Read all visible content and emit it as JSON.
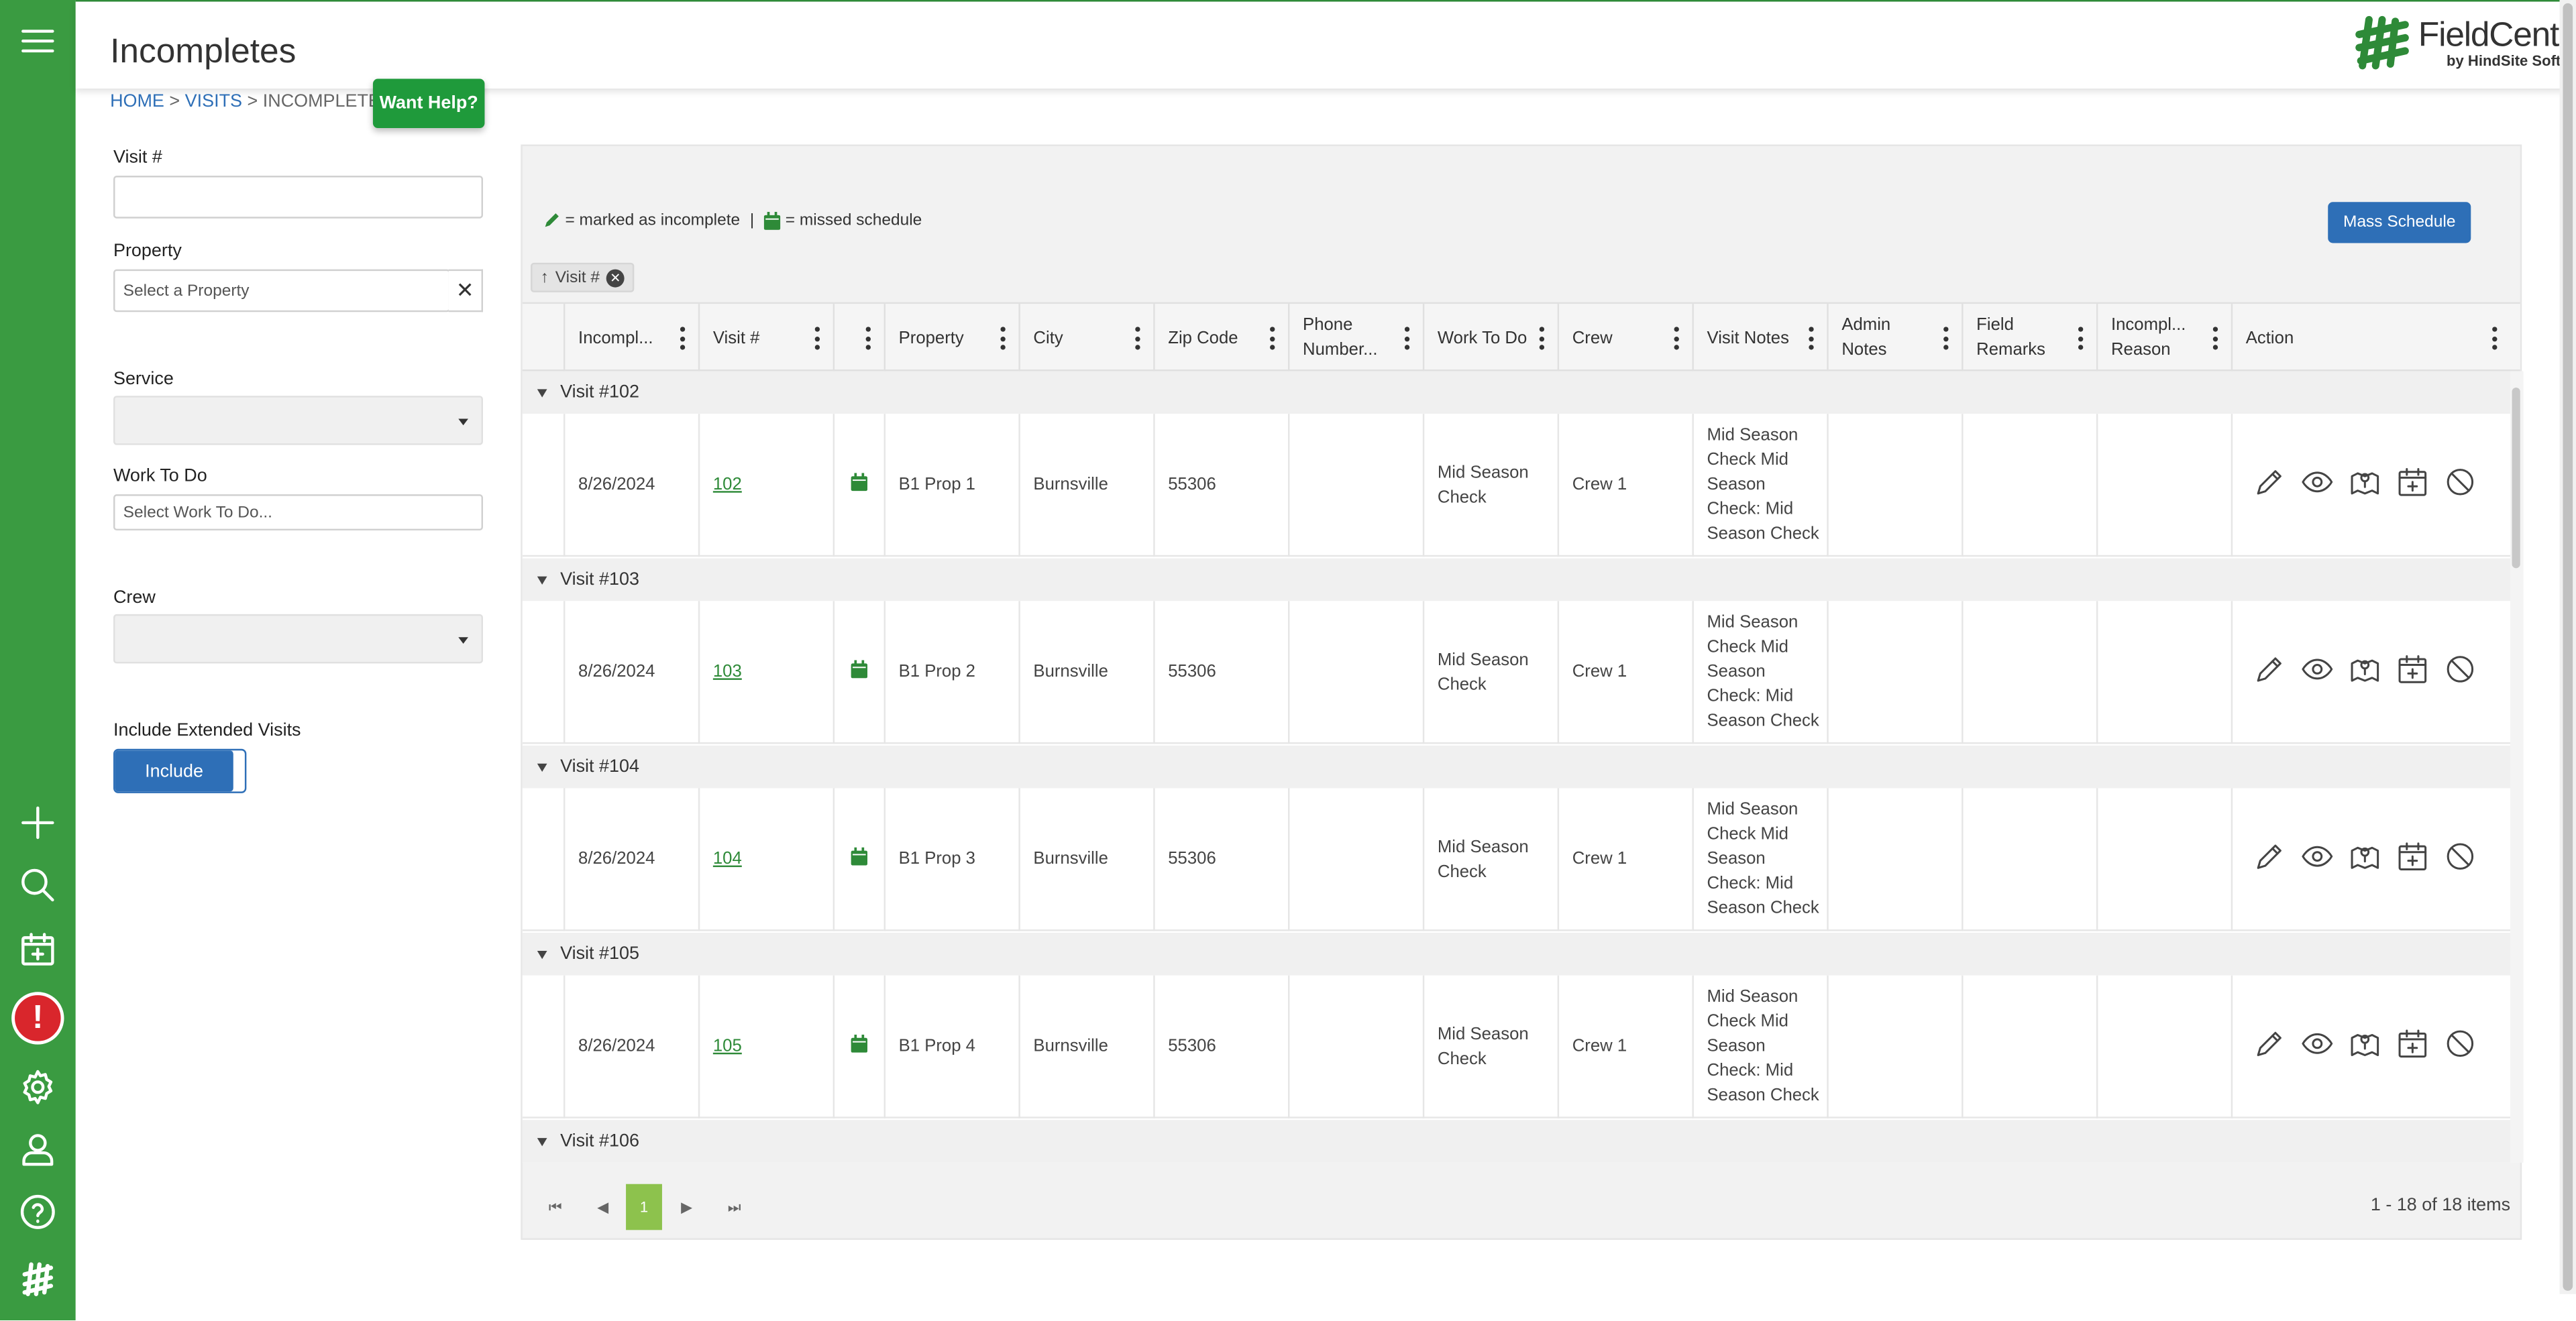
{
  "page": {
    "title": "Incompletes"
  },
  "breadcrumb": {
    "home": "HOME",
    "visits": "VISITS",
    "current": "INCOMPLETES",
    "sep": ">"
  },
  "help_button": "Want Help?",
  "logo": {
    "main": "FieldCentral",
    "sub": "by HindSite Software"
  },
  "filters": {
    "visit_label": "Visit #",
    "visit_value": "",
    "property_label": "Property",
    "property_placeholder": "Select a Property",
    "service_label": "Service",
    "work_label": "Work To Do",
    "work_placeholder": "Select Work To Do...",
    "crew_label": "Crew",
    "extended_label": "Include Extended Visits",
    "extended_toggle": "Include"
  },
  "legend": {
    "incomplete": "= marked as incomplete",
    "divider": "|",
    "missed": "= missed schedule"
  },
  "mass_schedule": "Mass Schedule",
  "grouping": {
    "chip": "Visit #",
    "arrow": "↑"
  },
  "columns": [
    "Incompl...",
    "Visit #",
    "",
    "Property",
    "City",
    "Zip Code",
    "Phone Number...",
    "Work To Do",
    "Crew",
    "Visit Notes",
    "Admin Notes",
    "Field Remarks",
    "Incompl... Reason",
    "Action"
  ],
  "groups": [
    {
      "label": "Visit #102",
      "row": {
        "date": "8/26/2024",
        "visit": "102",
        "property": "B1 Prop 1",
        "city": "Burnsville",
        "zip": "55306",
        "phone": "",
        "work": "Mid Season Check",
        "crew": "Crew 1",
        "notes": "Mid Season Check Mid Season Check: Mid Season Check",
        "admin": "",
        "remarks": "",
        "reason": ""
      }
    },
    {
      "label": "Visit #103",
      "row": {
        "date": "8/26/2024",
        "visit": "103",
        "property": "B1 Prop 2",
        "city": "Burnsville",
        "zip": "55306",
        "phone": "",
        "work": "Mid Season Check",
        "crew": "Crew 1",
        "notes": "Mid Season Check Mid Season Check: Mid Season Check",
        "admin": "",
        "remarks": "",
        "reason": ""
      }
    },
    {
      "label": "Visit #104",
      "row": {
        "date": "8/26/2024",
        "visit": "104",
        "property": "B1 Prop 3",
        "city": "Burnsville",
        "zip": "55306",
        "phone": "",
        "work": "Mid Season Check",
        "crew": "Crew 1",
        "notes": "Mid Season Check Mid Season Check: Mid Season Check",
        "admin": "",
        "remarks": "",
        "reason": ""
      }
    },
    {
      "label": "Visit #105",
      "row": {
        "date": "8/26/2024",
        "visit": "105",
        "property": "B1 Prop 4",
        "city": "Burnsville",
        "zip": "55306",
        "phone": "",
        "work": "Mid Season Check",
        "crew": "Crew 1",
        "notes": "Mid Season Check Mid Season Check: Mid Season Check",
        "admin": "",
        "remarks": "",
        "reason": ""
      }
    },
    {
      "label": "Visit #106"
    }
  ],
  "pager": {
    "current": "1",
    "info": "1 - 18 of 18 items"
  },
  "icons": {
    "sidebar": [
      "menu-icon",
      "plus-icon",
      "search-icon",
      "calendar-add-icon",
      "alert-icon",
      "gear-icon",
      "user-icon",
      "help-icon",
      "fieldcentral-logo-icon"
    ],
    "actions": [
      "pencil-icon",
      "eye-icon",
      "map-pin-icon",
      "calendar-add-icon",
      "cancel-icon"
    ]
  },
  "colors": {
    "sidebar": "#3a9b41",
    "link": "#2e6fb7",
    "accent_green": "#2e8a38",
    "button_blue": "#2e6fb7",
    "alert_red": "#d9262c",
    "pager_active": "#8dc24d"
  }
}
